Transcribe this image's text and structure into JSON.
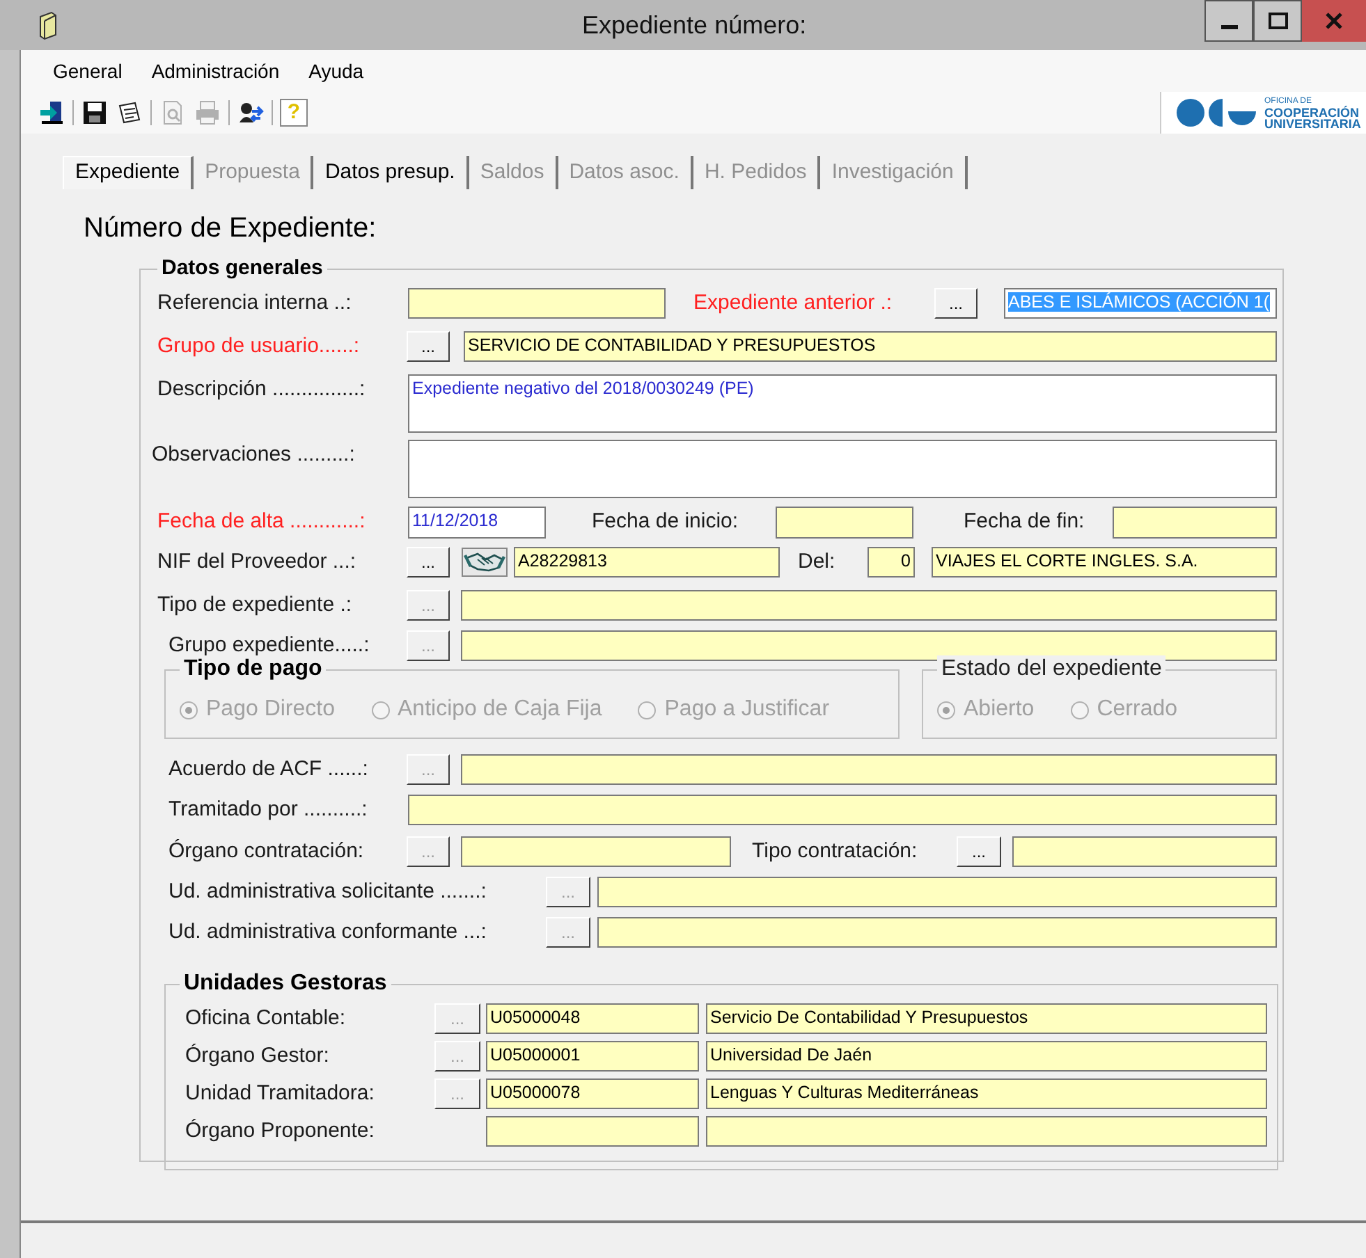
{
  "window": {
    "title": "Expediente número:"
  },
  "menu": [
    "General",
    "Administración",
    "Ayuda"
  ],
  "toolbar": [
    {
      "kind": "exit",
      "disabled": false
    },
    {
      "kind": "save",
      "disabled": false
    },
    {
      "kind": "edit",
      "disabled": false
    },
    {
      "kind": "preview",
      "disabled": true
    },
    {
      "kind": "print",
      "disabled": true
    },
    {
      "kind": "swap",
      "disabled": false
    },
    {
      "kind": "help",
      "disabled": false,
      "text": "?"
    }
  ],
  "logo": {
    "lines": [
      "OFICINA DE",
      "COOPERACIÓN",
      "UNIVERSITARIA"
    ]
  },
  "tabs": [
    {
      "label": "Expediente",
      "selected": true,
      "disabled": false
    },
    {
      "label": "Propuesta",
      "selected": false,
      "disabled": true
    },
    {
      "label": "Datos presup.",
      "selected": false,
      "disabled": false
    },
    {
      "label": "Saldos",
      "selected": false,
      "disabled": true
    },
    {
      "label": "Datos asoc.",
      "selected": false,
      "disabled": true
    },
    {
      "label": "H. Pedidos",
      "selected": false,
      "disabled": true
    },
    {
      "label": "Investigación",
      "selected": false,
      "disabled": true
    }
  ],
  "heading": "Número de Expediente:",
  "datos_generales": {
    "title": "Datos generales",
    "rows": [
      {
        "items": [
          {
            "kind": "label",
            "text": "Referencia interna ..:",
            "required": false
          },
          {
            "kind": "field",
            "editable": false
          },
          {
            "kind": "label",
            "text": "Expediente anterior .:",
            "required": true
          },
          {
            "kind": "button",
            "text": "...",
            "disabled": false
          },
          {
            "kind": "field",
            "value": "ABES E ISLÁMICOS (ACCIÓN 1(",
            "editable": true,
            "selected": true
          }
        ]
      },
      {
        "items": [
          {
            "kind": "label",
            "text": "Grupo de usuario......:",
            "required": true
          },
          {
            "kind": "button",
            "text": "...",
            "disabled": false
          },
          {
            "kind": "field",
            "value": "SERVICIO DE CONTABILIDAD Y PRESUPUESTOS",
            "editable": false
          }
        ]
      },
      {
        "items": [
          {
            "kind": "label",
            "text": "Descripción ...............:",
            "required": false
          },
          {
            "kind": "field",
            "value": "Expediente negativo del 2018/0030249 (PE)",
            "editable": true
          }
        ]
      },
      {
        "items": [
          {
            "kind": "label",
            "text": "Observaciones .........:",
            "required": false
          },
          {
            "kind": "field",
            "editable": true
          }
        ]
      },
      {
        "items": [
          {
            "kind": "label",
            "text": "Fecha de alta ............:",
            "required": true
          },
          {
            "kind": "field",
            "value": "11/12/2018",
            "editable": true
          },
          {
            "kind": "label",
            "text": "Fecha de inicio:",
            "required": false
          },
          {
            "kind": "field",
            "editable": false
          },
          {
            "kind": "label",
            "text": "Fecha de fin:",
            "required": false
          },
          {
            "kind": "field",
            "editable": false
          }
        ]
      },
      {
        "items": [
          {
            "kind": "label",
            "text": "NIF del Proveedor ...:",
            "required": false
          },
          {
            "kind": "button",
            "text": "...",
            "disabled": false
          },
          {
            "kind": "icon"
          },
          {
            "kind": "field",
            "value": "A28229813",
            "editable": false
          },
          {
            "kind": "label",
            "text": "Del:",
            "required": false
          },
          {
            "kind": "field",
            "value": "0",
            "editable": false
          },
          {
            "kind": "field",
            "value": "VIAJES EL CORTE INGLES. S.A.",
            "editable": false
          }
        ]
      },
      {
        "items": [
          {
            "kind": "label",
            "text": "Tipo de expediente .:",
            "required": false
          },
          {
            "kind": "button",
            "text": "...",
            "disabled": true
          },
          {
            "kind": "field",
            "editable": false
          }
        ]
      },
      {
        "items": [
          {
            "kind": "label",
            "text": "Grupo expediente.....:",
            "required": false
          },
          {
            "kind": "button",
            "text": "...",
            "disabled": true
          },
          {
            "kind": "field",
            "editable": false
          }
        ]
      }
    ],
    "tipo_de_pago": {
      "title": "Tipo de pago",
      "disabled": true,
      "options": [
        {
          "label": "Pago Directo",
          "selected": true
        },
        {
          "label": "Anticipo de Caja Fija",
          "selected": false
        },
        {
          "label": "Pago a Justificar",
          "selected": false
        }
      ]
    },
    "estado": {
      "title": "Estado del expediente",
      "disabled": true,
      "options": [
        {
          "label": "Abierto",
          "selected": true
        },
        {
          "label": "Cerrado",
          "selected": false
        }
      ]
    },
    "rows_2": [
      {
        "items": [
          {
            "kind": "label",
            "text": "Acuerdo de ACF ......:",
            "required": false
          },
          {
            "kind": "button",
            "text": "...",
            "disabled": true
          },
          {
            "kind": "field",
            "editable": false
          }
        ]
      },
      {
        "items": [
          {
            "kind": "label",
            "text": "Tramitado por ..........:",
            "required": false
          },
          {
            "kind": "field",
            "editable": false
          }
        ]
      },
      {
        "items": [
          {
            "kind": "label",
            "text": "Órgano contratación:",
            "required": false
          },
          {
            "kind": "button",
            "text": "...",
            "disabled": true
          },
          {
            "kind": "field",
            "editable": false
          },
          {
            "kind": "label",
            "text": "Tipo contratación:",
            "required": false
          },
          {
            "kind": "button",
            "text": "...",
            "disabled": false
          },
          {
            "kind": "field",
            "editable": false
          }
        ]
      },
      {
        "items": [
          {
            "kind": "label",
            "text": "Ud. administrativa solicitante .......:",
            "required": false
          },
          {
            "kind": "button",
            "text": "...",
            "disabled": true
          },
          {
            "kind": "field",
            "editable": false
          }
        ]
      },
      {
        "items": [
          {
            "kind": "label",
            "text": "Ud. administrativa conformante ...:",
            "required": false
          },
          {
            "kind": "button",
            "text": "...",
            "disabled": true
          },
          {
            "kind": "field",
            "editable": false
          }
        ]
      }
    ],
    "unidades_gestoras": {
      "title": "Unidades Gestoras",
      "rows": [
        {
          "items": [
            {
              "kind": "label",
              "text": "Oficina Contable:",
              "required": false
            },
            {
              "kind": "button",
              "text": "...",
              "disabled": true
            },
            {
              "kind": "field",
              "value": "U05000048",
              "editable": false
            },
            {
              "kind": "field",
              "value": "Servicio De Contabilidad Y Presupuestos",
              "editable": false
            }
          ]
        },
        {
          "items": [
            {
              "kind": "label",
              "text": "Órgano Gestor:",
              "required": false
            },
            {
              "kind": "button",
              "text": "...",
              "disabled": true
            },
            {
              "kind": "field",
              "value": "U05000001",
              "editable": false
            },
            {
              "kind": "field",
              "value": "Universidad De Jaén",
              "editable": false
            }
          ]
        },
        {
          "items": [
            {
              "kind": "label",
              "text": "Unidad Tramitadora:",
              "required": false
            },
            {
              "kind": "button",
              "text": "...",
              "disabled": true
            },
            {
              "kind": "field",
              "value": "U05000078",
              "editable": false
            },
            {
              "kind": "field",
              "value": "Lenguas Y Culturas Mediterráneas",
              "editable": false
            }
          ]
        },
        {
          "items": [
            {
              "kind": "label",
              "text": "Órgano Proponente:",
              "required": false
            },
            {
              "kind": "field",
              "editable": false
            },
            {
              "kind": "field",
              "editable": false
            }
          ]
        }
      ]
    }
  }
}
